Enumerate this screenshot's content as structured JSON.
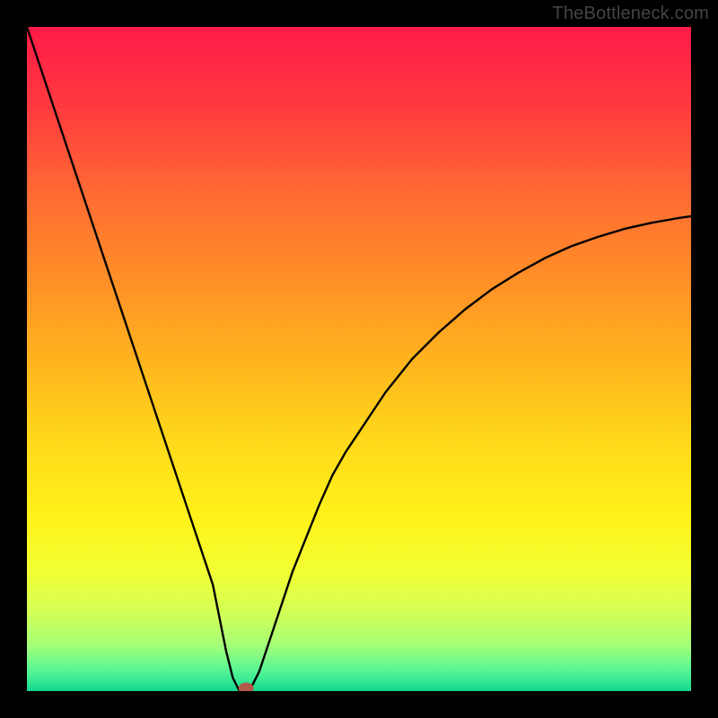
{
  "watermark": "TheBottleneck.com",
  "chart_data": {
    "type": "line",
    "title": "",
    "xlabel": "",
    "ylabel": "",
    "xlim": [
      0,
      100
    ],
    "ylim": [
      0,
      100
    ],
    "grid": false,
    "legend": false,
    "series": [
      {
        "name": "bottleneck-curve",
        "x": [
          0,
          2,
          4,
          6,
          8,
          10,
          12,
          14,
          16,
          18,
          20,
          22,
          24,
          26,
          28,
          30,
          31,
          32,
          33,
          34,
          35,
          36,
          38,
          40,
          42,
          44,
          46,
          48,
          50,
          54,
          58,
          62,
          66,
          70,
          74,
          78,
          82,
          86,
          90,
          94,
          98,
          100
        ],
        "y": [
          100,
          94,
          88,
          82,
          76,
          70,
          64,
          58,
          52,
          46,
          40,
          34,
          28,
          22,
          16,
          6,
          2,
          0,
          0,
          1,
          3,
          6,
          12,
          18,
          23,
          28,
          32.5,
          36,
          39,
          45,
          50,
          54,
          57.5,
          60.5,
          63,
          65.2,
          67,
          68.4,
          69.6,
          70.5,
          71.2,
          71.5
        ]
      }
    ],
    "marker": {
      "x": 33,
      "y": 0,
      "color": "#b55a4a"
    },
    "background_gradient": {
      "stops": [
        {
          "offset": 0.0,
          "color": "#ff1a48"
        },
        {
          "offset": 0.12,
          "color": "#ff3a3f"
        },
        {
          "offset": 0.25,
          "color": "#ff6a33"
        },
        {
          "offset": 0.38,
          "color": "#ff8f27"
        },
        {
          "offset": 0.5,
          "color": "#ffb31e"
        },
        {
          "offset": 0.62,
          "color": "#ffd81a"
        },
        {
          "offset": 0.74,
          "color": "#fff21a"
        },
        {
          "offset": 0.82,
          "color": "#f2ff33"
        },
        {
          "offset": 0.88,
          "color": "#d4ff55"
        },
        {
          "offset": 0.93,
          "color": "#a6ff76"
        },
        {
          "offset": 0.97,
          "color": "#55f596"
        },
        {
          "offset": 1.0,
          "color": "#13d890"
        }
      ]
    }
  }
}
